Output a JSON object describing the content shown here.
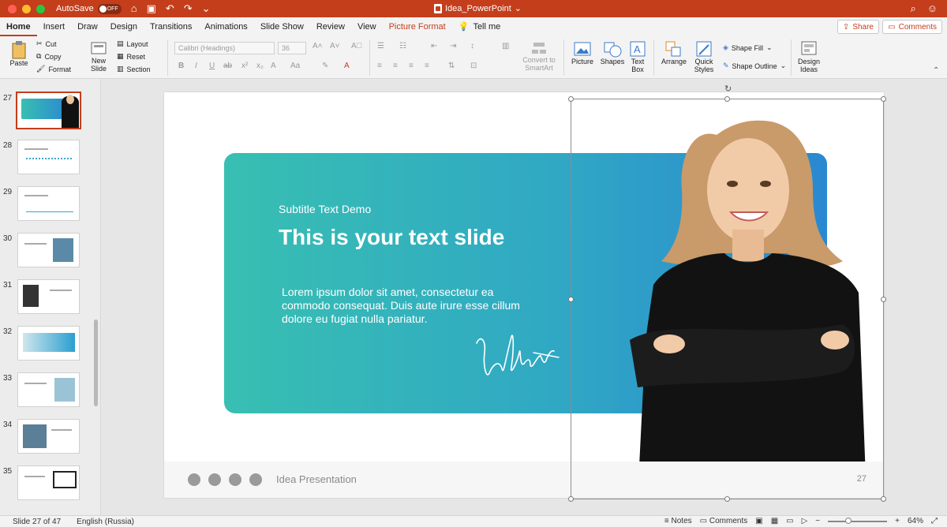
{
  "window": {
    "autosave_label": "AutoSave",
    "autosave_state": "OFF",
    "doc_title": "Idea_PowerPoint"
  },
  "ribbon_tabs": [
    {
      "label": "Home",
      "active": true
    },
    {
      "label": "Insert"
    },
    {
      "label": "Draw"
    },
    {
      "label": "Design"
    },
    {
      "label": "Transitions"
    },
    {
      "label": "Animations"
    },
    {
      "label": "Slide Show"
    },
    {
      "label": "Review"
    },
    {
      "label": "View"
    },
    {
      "label": "Picture Format",
      "contextual": true
    },
    {
      "label": "Tell me"
    }
  ],
  "share_label": "Share",
  "comments_label": "Comments",
  "ribbon": {
    "paste": "Paste",
    "cut": "Cut",
    "copy": "Copy",
    "format": "Format",
    "new_slide_1": "New",
    "new_slide_2": "Slide",
    "layout": "Layout",
    "reset": "Reset",
    "section": "Section",
    "font_name": "Calibri (Headings)",
    "font_size": "36",
    "convert_1": "Convert to",
    "convert_2": "SmartArt",
    "picture": "Picture",
    "shapes": "Shapes",
    "textbox_1": "Text",
    "textbox_2": "Box",
    "arrange": "Arrange",
    "quick_1": "Quick",
    "quick_2": "Styles",
    "shape_fill": "Shape Fill",
    "shape_outline": "Shape Outline",
    "design_1": "Design",
    "design_2": "Ideas"
  },
  "thumbnails": [
    {
      "num": "27"
    },
    {
      "num": "28"
    },
    {
      "num": "29"
    },
    {
      "num": "30"
    },
    {
      "num": "31"
    },
    {
      "num": "32"
    },
    {
      "num": "33"
    },
    {
      "num": "34"
    },
    {
      "num": "35"
    }
  ],
  "slide": {
    "subtitle": "Subtitle Text Demo",
    "title": "This is your text slide",
    "body": "Lorem ipsum dolor sit amet, consectetur ea commodo consequat. Duis aute irure esse cillum dolore eu fugiat nulla pariatur.",
    "footer_text": "Idea Presentation",
    "page_number": "27"
  },
  "status": {
    "slide_info": "Slide 27 of 47",
    "language": "English (Russia)",
    "notes": "Notes",
    "comments": "Comments",
    "zoom": "64%"
  },
  "colors": {
    "accent": "#c43e1c",
    "panel_start": "#38bfb2",
    "panel_end": "#2a88d0"
  }
}
